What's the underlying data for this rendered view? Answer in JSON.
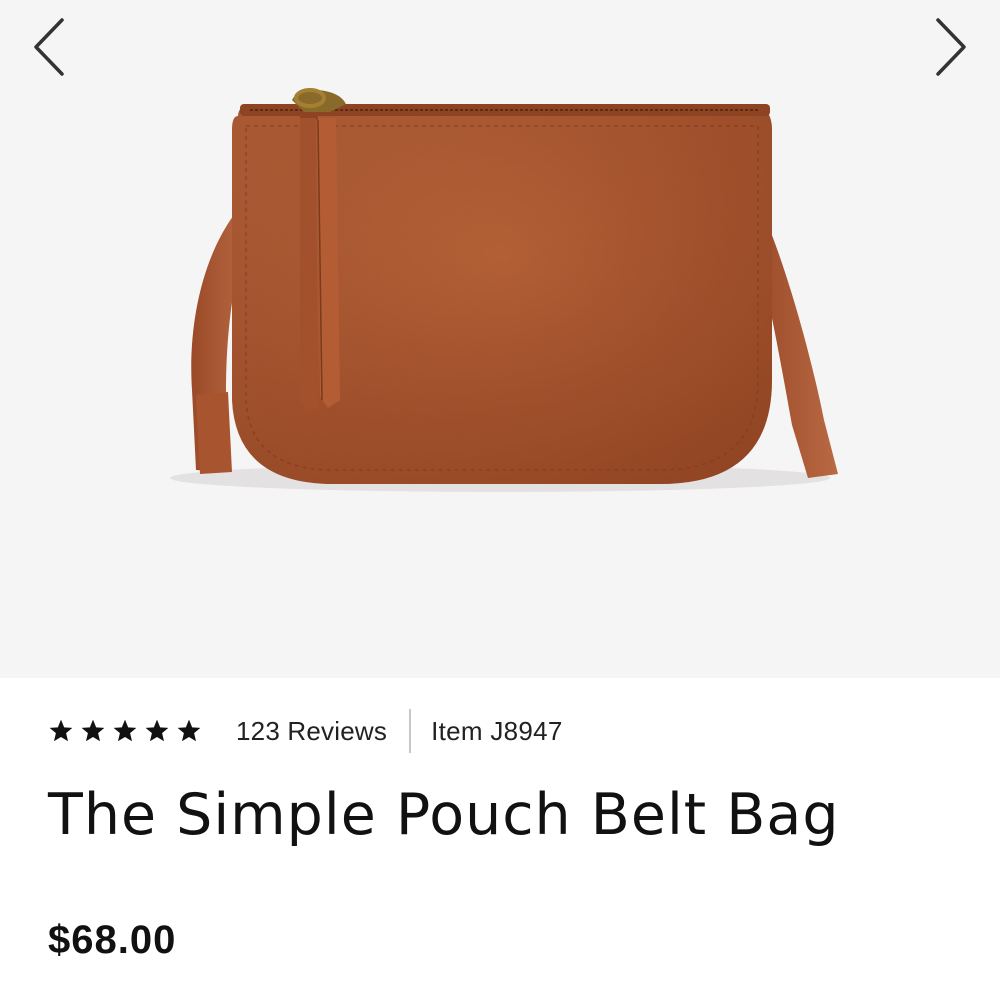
{
  "gallery": {
    "prev_icon": "chevron-left-icon",
    "next_icon": "chevron-right-icon",
    "image_subject": "cognac leather crossbody pouch bag"
  },
  "product": {
    "rating_stars": 5,
    "rating_icon": "star-icon",
    "reviews_label": "123 Reviews",
    "item_label": "Item J8947",
    "title": "The Simple Pouch Belt Bag",
    "price": "$68.00"
  },
  "colors": {
    "leather": "#b05a34",
    "gallery_bg": "#f6f5f6",
    "star": "#111111"
  }
}
